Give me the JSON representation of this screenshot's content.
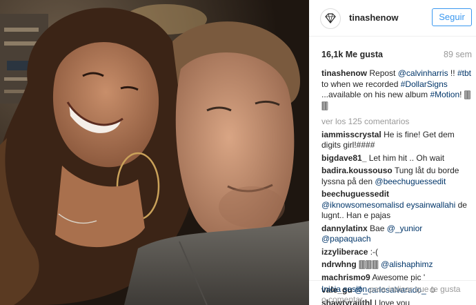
{
  "post": {
    "username": "tinashenow",
    "follow_label": "Seguir",
    "likes": "16,1k Me gusta",
    "time": "89 sem",
    "caption": {
      "user": "tinashenow",
      "parts": [
        {
          "text": " Repost "
        },
        {
          "mention": "@calvinharris"
        },
        {
          "text": " !! "
        },
        {
          "mention": "#tbt"
        },
        {
          "text": " to when we recorded "
        },
        {
          "mention": "#DollarSigns"
        },
        {
          "text": " ...available on his new album "
        },
        {
          "mention": "#Motion"
        },
        {
          "text": "! 🀫🀫"
        }
      ]
    },
    "view_all": "ver los 125 comentarios",
    "comments": [
      {
        "user": "iammisscrystal",
        "parts": [
          {
            "text": " He is fine! Get dem digits girl!####"
          }
        ]
      },
      {
        "user": "bigdave81_",
        "parts": [
          {
            "text": " Let him hit .. Oh wait"
          }
        ]
      },
      {
        "user": "badira.koussouso",
        "parts": [
          {
            "text": " Tung låt du borde lyssna på den "
          },
          {
            "mention": "@beechuguessedit"
          }
        ]
      },
      {
        "user": "beechuguessedit",
        "parts": [
          {
            "text": " "
          },
          {
            "mention": "@iknowsomesomalisd eysainwallahi"
          },
          {
            "text": " de lugnt.. Han e pajas"
          }
        ]
      },
      {
        "user": "dannylatinx",
        "parts": [
          {
            "text": " Bae "
          },
          {
            "mention": "@_yunior"
          },
          {
            "text": " "
          },
          {
            "mention": "@papaquach"
          }
        ]
      },
      {
        "user": "izzyliberace",
        "parts": [
          {
            "text": " :-("
          }
        ]
      },
      {
        "user": "ndrwhng",
        "parts": [
          {
            "text": " 🀫🀫🀫 "
          },
          {
            "mention": "@alishaphimz"
          }
        ]
      },
      {
        "user": "machrismo9",
        "parts": [
          {
            "text": " Awesome pic '"
          }
        ]
      },
      {
        "user": "vale_gu",
        "parts": [
          {
            "text": " "
          },
          {
            "mention": "@_carlosalvarado_"
          },
          {
            "text": " ☺"
          }
        ]
      },
      {
        "user": "shawtyrailthl",
        "parts": [
          {
            "text": " I love you"
          }
        ]
      }
    ],
    "footer": {
      "login": "Inicia sesión",
      "rest": " para indicar que te gusta o comentar."
    }
  },
  "colors": {
    "link": "#003569",
    "button": "#3897f0",
    "muted": "#999999"
  }
}
